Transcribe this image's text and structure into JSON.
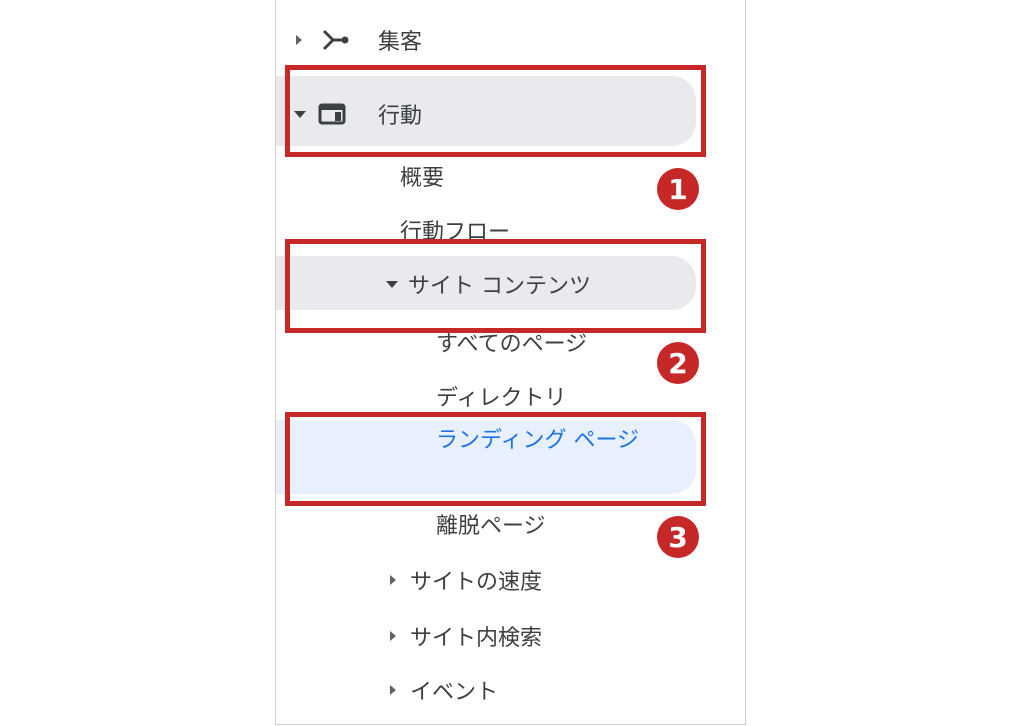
{
  "nav": {
    "acquisition": {
      "label": "集客",
      "icon": "acquisition-branch-icon"
    },
    "behavior": {
      "label": "行動",
      "icon": "behavior-panel-icon"
    },
    "overview": {
      "label": "概要"
    },
    "behavior_flow": {
      "label": "行動フロー"
    },
    "site_content": {
      "label": "サイト コンテンツ",
      "children": [
        {
          "label": "すべてのページ"
        },
        {
          "label": "ディレクトリ"
        },
        {
          "label": "ランディング ページ",
          "selected": true
        },
        {
          "label": "離脱ページ"
        }
      ]
    },
    "site_speed": {
      "label": "サイトの速度"
    },
    "site_search": {
      "label": "サイト内検索"
    },
    "events": {
      "label": "イベント"
    }
  },
  "annotations": {
    "badges": [
      "1",
      "2",
      "3"
    ],
    "color": "#c62828"
  },
  "colors": {
    "selected_text": "#1a73e8",
    "selected_bg": "#e8f0fe",
    "expanded_bg": "#e8eaed"
  }
}
